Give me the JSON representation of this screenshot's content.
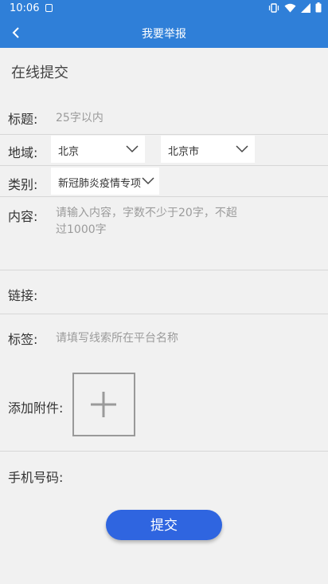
{
  "status_bar": {
    "time": "10:06",
    "icons": [
      "notification-icon",
      "vibrate-icon",
      "wifi-icon",
      "signal-icon",
      "battery-icon"
    ]
  },
  "app_bar": {
    "title": "我要举报",
    "back_icon": "chevron-left-icon",
    "color": "#2f7fd8"
  },
  "form": {
    "section_title": "在线提交",
    "title_label": "标题:",
    "title_placeholder": "25字以内",
    "region_label": "地域:",
    "province_value": "北京",
    "city_value": "北京市",
    "category_label": "类别:",
    "category_value": "新冠肺炎疫情专项",
    "content_label": "内容:",
    "content_placeholder": "请输入内容，字数不少于20字，不超过1000字",
    "link_label": "链接:",
    "tag_label": "标签:",
    "tag_placeholder": "请填写线索所在平台名称",
    "attachment_label": "添加附件:",
    "phone_label": "手机号码:",
    "submit_label": "提交",
    "submit_color": "#2f65e0"
  }
}
